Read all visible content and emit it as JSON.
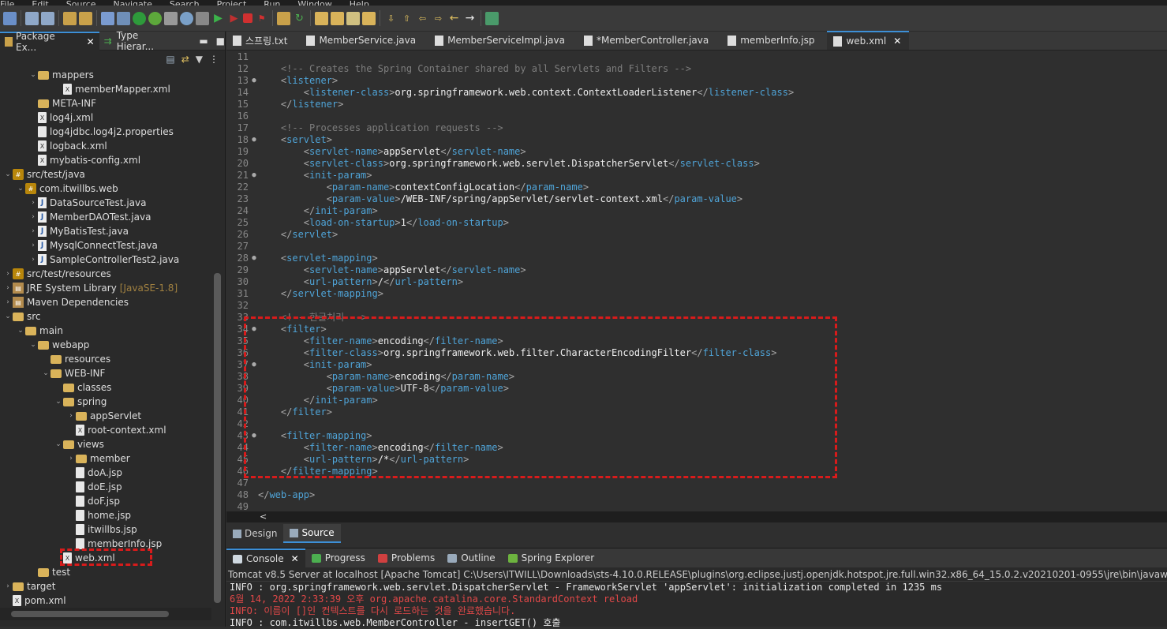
{
  "menu": [
    "File",
    "Edit",
    "Source",
    "Navigate",
    "Search",
    "Project",
    "Run",
    "Window",
    "Help"
  ],
  "left_tabs": [
    {
      "label": "Package Ex...",
      "active": true
    },
    {
      "label": "Type Hierar...",
      "active": false
    }
  ],
  "tree": [
    {
      "indent": 3,
      "tw": "v",
      "icon": "folder",
      "label": "mappers"
    },
    {
      "indent": 5,
      "tw": "",
      "icon": "xml",
      "label": "memberMapper.xml"
    },
    {
      "indent": 3,
      "tw": "",
      "icon": "folder",
      "label": "META-INF"
    },
    {
      "indent": 3,
      "tw": "",
      "icon": "xml",
      "label": "log4j.xml"
    },
    {
      "indent": 3,
      "tw": "",
      "icon": "file",
      "label": "log4jdbc.log4j2.properties"
    },
    {
      "indent": 3,
      "tw": "",
      "icon": "xml",
      "label": "logback.xml"
    },
    {
      "indent": 3,
      "tw": "",
      "icon": "xml",
      "label": "mybatis-config.xml"
    },
    {
      "indent": 1,
      "tw": "v",
      "icon": "pkg",
      "label": "src/test/java"
    },
    {
      "indent": 2,
      "tw": "v",
      "icon": "pkg",
      "label": "com.itwillbs.web"
    },
    {
      "indent": 3,
      "tw": ">",
      "icon": "java",
      "label": "DataSourceTest.java"
    },
    {
      "indent": 3,
      "tw": ">",
      "icon": "java",
      "label": "MemberDAOTest.java"
    },
    {
      "indent": 3,
      "tw": ">",
      "icon": "java",
      "label": "MyBatisTest.java"
    },
    {
      "indent": 3,
      "tw": ">",
      "icon": "java",
      "label": "MysqlConnectTest.java"
    },
    {
      "indent": 3,
      "tw": ">",
      "icon": "java",
      "label": "SampleControllerTest2.java"
    },
    {
      "indent": 1,
      "tw": ">",
      "icon": "pkg",
      "label": "src/test/resources"
    },
    {
      "indent": 1,
      "tw": ">",
      "icon": "lib",
      "label": "JRE System Library",
      "decor": "[JavaSE-1.8]"
    },
    {
      "indent": 1,
      "tw": ">",
      "icon": "lib",
      "label": "Maven Dependencies"
    },
    {
      "indent": 1,
      "tw": "v",
      "icon": "folder",
      "label": "src"
    },
    {
      "indent": 2,
      "tw": "v",
      "icon": "folder",
      "label": "main"
    },
    {
      "indent": 3,
      "tw": "v",
      "icon": "folder",
      "label": "webapp"
    },
    {
      "indent": 4,
      "tw": "",
      "icon": "folder",
      "label": "resources"
    },
    {
      "indent": 4,
      "tw": "v",
      "icon": "folder",
      "label": "WEB-INF"
    },
    {
      "indent": 5,
      "tw": "",
      "icon": "folder",
      "label": "classes"
    },
    {
      "indent": 5,
      "tw": "v",
      "icon": "folder",
      "label": "spring"
    },
    {
      "indent": 6,
      "tw": ">",
      "icon": "folder",
      "label": "appServlet"
    },
    {
      "indent": 6,
      "tw": "",
      "icon": "xml",
      "label": "root-context.xml"
    },
    {
      "indent": 5,
      "tw": "v",
      "icon": "folder",
      "label": "views"
    },
    {
      "indent": 6,
      "tw": ">",
      "icon": "folder",
      "label": "member"
    },
    {
      "indent": 6,
      "tw": "",
      "icon": "file",
      "label": "doA.jsp"
    },
    {
      "indent": 6,
      "tw": "",
      "icon": "file",
      "label": "doE.jsp"
    },
    {
      "indent": 6,
      "tw": "",
      "icon": "file",
      "label": "doF.jsp"
    },
    {
      "indent": 6,
      "tw": "",
      "icon": "file",
      "label": "home.jsp"
    },
    {
      "indent": 6,
      "tw": "",
      "icon": "file",
      "label": "itwillbs.jsp"
    },
    {
      "indent": 6,
      "tw": "",
      "icon": "file",
      "label": "memberInfo.jsp"
    },
    {
      "indent": 5,
      "tw": "",
      "icon": "xml",
      "label": "web.xml"
    },
    {
      "indent": 3,
      "tw": "",
      "icon": "folder",
      "label": "test"
    },
    {
      "indent": 1,
      "tw": ">",
      "icon": "folder",
      "label": "target"
    },
    {
      "indent": 1,
      "tw": "",
      "icon": "xml",
      "label": "pom.xml"
    }
  ],
  "editor_tabs": [
    {
      "label": "스프링.txt",
      "active": false
    },
    {
      "label": "MemberService.java",
      "active": false
    },
    {
      "label": "MemberServiceImpl.java",
      "active": false
    },
    {
      "label": "*MemberController.java",
      "active": false
    },
    {
      "label": "memberInfo.jsp",
      "active": false
    },
    {
      "label": "web.xml",
      "active": true
    }
  ],
  "code_lines": [
    {
      "n": "11",
      "fold": "",
      "parts": []
    },
    {
      "n": "12",
      "fold": "",
      "parts": [
        [
          "cm",
          "    <!-- Creates the Spring Container shared by all Servlets and Filters -->"
        ]
      ]
    },
    {
      "n": "13",
      "fold": "●",
      "parts": [
        [
          "br",
          "    <"
        ],
        [
          "tag",
          "listener"
        ],
        [
          "br",
          ">"
        ]
      ]
    },
    {
      "n": "14",
      "fold": "",
      "parts": [
        [
          "br",
          "        <"
        ],
        [
          "tag",
          "listener-class"
        ],
        [
          "br",
          ">"
        ],
        [
          "tx",
          "org.springframework.web.context.ContextLoaderListener"
        ],
        [
          "br",
          "</"
        ],
        [
          "tag",
          "listener-class"
        ],
        [
          "br",
          ">"
        ]
      ]
    },
    {
      "n": "15",
      "fold": "",
      "parts": [
        [
          "br",
          "    </"
        ],
        [
          "tag",
          "listener"
        ],
        [
          "br",
          ">"
        ]
      ]
    },
    {
      "n": "16",
      "fold": "",
      "parts": []
    },
    {
      "n": "17",
      "fold": "",
      "parts": [
        [
          "cm",
          "    <!-- Processes application requests -->"
        ]
      ]
    },
    {
      "n": "18",
      "fold": "●",
      "parts": [
        [
          "br",
          "    <"
        ],
        [
          "tag",
          "servlet"
        ],
        [
          "br",
          ">"
        ]
      ]
    },
    {
      "n": "19",
      "fold": "",
      "parts": [
        [
          "br",
          "        <"
        ],
        [
          "tag",
          "servlet-name"
        ],
        [
          "br",
          ">"
        ],
        [
          "tx",
          "appServlet"
        ],
        [
          "br",
          "</"
        ],
        [
          "tag",
          "servlet-name"
        ],
        [
          "br",
          ">"
        ]
      ]
    },
    {
      "n": "20",
      "fold": "",
      "parts": [
        [
          "br",
          "        <"
        ],
        [
          "tag",
          "servlet-class"
        ],
        [
          "br",
          ">"
        ],
        [
          "tx",
          "org.springframework.web.servlet.DispatcherServlet"
        ],
        [
          "br",
          "</"
        ],
        [
          "tag",
          "servlet-class"
        ],
        [
          "br",
          ">"
        ]
      ]
    },
    {
      "n": "21",
      "fold": "●",
      "parts": [
        [
          "br",
          "        <"
        ],
        [
          "tag",
          "init-param"
        ],
        [
          "br",
          ">"
        ]
      ]
    },
    {
      "n": "22",
      "fold": "",
      "parts": [
        [
          "br",
          "            <"
        ],
        [
          "tag",
          "param-name"
        ],
        [
          "br",
          ">"
        ],
        [
          "tx",
          "contextConfigLocation"
        ],
        [
          "br",
          "</"
        ],
        [
          "tag",
          "param-name"
        ],
        [
          "br",
          ">"
        ]
      ]
    },
    {
      "n": "23",
      "fold": "",
      "parts": [
        [
          "br",
          "            <"
        ],
        [
          "tag",
          "param-value"
        ],
        [
          "br",
          ">"
        ],
        [
          "tx",
          "/WEB-INF/spring/appServlet/servlet-context.xml"
        ],
        [
          "br",
          "</"
        ],
        [
          "tag",
          "param-value"
        ],
        [
          "br",
          ">"
        ]
      ]
    },
    {
      "n": "24",
      "fold": "",
      "parts": [
        [
          "br",
          "        </"
        ],
        [
          "tag",
          "init-param"
        ],
        [
          "br",
          ">"
        ]
      ]
    },
    {
      "n": "25",
      "fold": "",
      "parts": [
        [
          "br",
          "        <"
        ],
        [
          "tag",
          "load-on-startup"
        ],
        [
          "br",
          ">"
        ],
        [
          "tx",
          "1"
        ],
        [
          "br",
          "</"
        ],
        [
          "tag",
          "load-on-startup"
        ],
        [
          "br",
          ">"
        ]
      ]
    },
    {
      "n": "26",
      "fold": "",
      "parts": [
        [
          "br",
          "    </"
        ],
        [
          "tag",
          "servlet"
        ],
        [
          "br",
          ">"
        ]
      ]
    },
    {
      "n": "27",
      "fold": "",
      "parts": []
    },
    {
      "n": "28",
      "fold": "●",
      "parts": [
        [
          "br",
          "    <"
        ],
        [
          "tag",
          "servlet-mapping"
        ],
        [
          "br",
          ">"
        ]
      ]
    },
    {
      "n": "29",
      "fold": "",
      "parts": [
        [
          "br",
          "        <"
        ],
        [
          "tag",
          "servlet-name"
        ],
        [
          "br",
          ">"
        ],
        [
          "tx",
          "appServlet"
        ],
        [
          "br",
          "</"
        ],
        [
          "tag",
          "servlet-name"
        ],
        [
          "br",
          ">"
        ]
      ]
    },
    {
      "n": "30",
      "fold": "",
      "parts": [
        [
          "br",
          "        <"
        ],
        [
          "tag",
          "url-pattern"
        ],
        [
          "br",
          ">"
        ],
        [
          "tx",
          "/"
        ],
        [
          "br",
          "</"
        ],
        [
          "tag",
          "url-pattern"
        ],
        [
          "br",
          ">"
        ]
      ]
    },
    {
      "n": "31",
      "fold": "",
      "parts": [
        [
          "br",
          "    </"
        ],
        [
          "tag",
          "servlet-mapping"
        ],
        [
          "br",
          ">"
        ]
      ]
    },
    {
      "n": "32",
      "fold": "",
      "parts": []
    },
    {
      "n": "33",
      "fold": "",
      "parts": [
        [
          "cm",
          "    <!-- 한글처리 -->"
        ]
      ]
    },
    {
      "n": "34",
      "fold": "●",
      "parts": [
        [
          "br",
          "    <"
        ],
        [
          "tag",
          "filter"
        ],
        [
          "br",
          ">"
        ]
      ]
    },
    {
      "n": "35",
      "fold": "",
      "parts": [
        [
          "br",
          "        <"
        ],
        [
          "tag",
          "filter-name"
        ],
        [
          "br",
          ">"
        ],
        [
          "tx",
          "encoding"
        ],
        [
          "br",
          "</"
        ],
        [
          "tag",
          "filter-name"
        ],
        [
          "br",
          ">"
        ]
      ]
    },
    {
      "n": "36",
      "fold": "",
      "parts": [
        [
          "br",
          "        <"
        ],
        [
          "tag",
          "filter-class"
        ],
        [
          "br",
          ">"
        ],
        [
          "tx",
          "org.springframework.web.filter.CharacterEncodingFilter"
        ],
        [
          "br",
          "</"
        ],
        [
          "tag",
          "filter-class"
        ],
        [
          "br",
          ">"
        ]
      ]
    },
    {
      "n": "37",
      "fold": "●",
      "parts": [
        [
          "br",
          "        <"
        ],
        [
          "tag",
          "init-param"
        ],
        [
          "br",
          ">"
        ]
      ]
    },
    {
      "n": "38",
      "fold": "",
      "parts": [
        [
          "br",
          "            <"
        ],
        [
          "tag",
          "param-name"
        ],
        [
          "br",
          ">"
        ],
        [
          "tx",
          "encoding"
        ],
        [
          "br",
          "</"
        ],
        [
          "tag",
          "param-name"
        ],
        [
          "br",
          ">"
        ]
      ]
    },
    {
      "n": "39",
      "fold": "",
      "parts": [
        [
          "br",
          "            <"
        ],
        [
          "tag",
          "param-value"
        ],
        [
          "br",
          ">"
        ],
        [
          "tx",
          "UTF-8"
        ],
        [
          "br",
          "</"
        ],
        [
          "tag",
          "param-value"
        ],
        [
          "br",
          ">"
        ]
      ]
    },
    {
      "n": "40",
      "fold": "",
      "parts": [
        [
          "br",
          "        </"
        ],
        [
          "tag",
          "init-param"
        ],
        [
          "br",
          ">"
        ]
      ]
    },
    {
      "n": "41",
      "fold": "",
      "parts": [
        [
          "br",
          "    </"
        ],
        [
          "tag",
          "filter"
        ],
        [
          "br",
          ">"
        ]
      ]
    },
    {
      "n": "42",
      "fold": "",
      "parts": []
    },
    {
      "n": "43",
      "fold": "●",
      "parts": [
        [
          "br",
          "    <"
        ],
        [
          "tag",
          "filter-mapping"
        ],
        [
          "br",
          ">"
        ]
      ]
    },
    {
      "n": "44",
      "fold": "",
      "parts": [
        [
          "br",
          "        <"
        ],
        [
          "tag",
          "filter-name"
        ],
        [
          "br",
          ">"
        ],
        [
          "tx",
          "encoding"
        ],
        [
          "br",
          "</"
        ],
        [
          "tag",
          "filter-name"
        ],
        [
          "br",
          ">"
        ]
      ]
    },
    {
      "n": "45",
      "fold": "",
      "parts": [
        [
          "br",
          "        <"
        ],
        [
          "tag",
          "url-pattern"
        ],
        [
          "br",
          ">"
        ],
        [
          "tx",
          "/*"
        ],
        [
          "br",
          "</"
        ],
        [
          "tag",
          "url-pattern"
        ],
        [
          "br",
          ">"
        ]
      ]
    },
    {
      "n": "46",
      "fold": "",
      "parts": [
        [
          "br",
          "    </"
        ],
        [
          "tag",
          "filter-mapping"
        ],
        [
          "br",
          ">"
        ]
      ]
    },
    {
      "n": "47",
      "fold": "",
      "parts": []
    },
    {
      "n": "48",
      "fold": "",
      "parts": [
        [
          "br",
          "</"
        ],
        [
          "tag",
          "web-app"
        ],
        [
          "br",
          ">"
        ]
      ]
    },
    {
      "n": "49",
      "fold": "",
      "parts": []
    }
  ],
  "design_tabs": [
    {
      "label": "Design",
      "active": false
    },
    {
      "label": "Source",
      "active": true
    }
  ],
  "console_tabs": [
    {
      "label": "Console",
      "active": true,
      "icon": "console-icon"
    },
    {
      "label": "Progress",
      "active": false,
      "icon": "progress-icon"
    },
    {
      "label": "Problems",
      "active": false,
      "icon": "problems-icon"
    },
    {
      "label": "Outline",
      "active": false,
      "icon": "outline-icon"
    },
    {
      "label": "Spring Explorer",
      "active": false,
      "icon": "spring-icon"
    }
  ],
  "console_title": "Tomcat v8.5 Server at localhost [Apache Tomcat] C:\\Users\\ITWILL\\Downloads\\sts-4.10.0.RELEASE\\plugins\\org.eclipse.justj.openjdk.hotspot.jre.full.win32.x86_64_15.0.2.v20210201-0955\\jre\\bin\\javaw.exe  (2022. 6.",
  "console_lines": [
    {
      "kind": "info",
      "text": "INFO : org.springframework.web.servlet.DispatcherServlet - FrameworkServlet 'appServlet': initialization completed in 1235 ms"
    },
    {
      "kind": "red",
      "text": "6월 14, 2022 2:33:39 오후 org.apache.catalina.core.StandardContext reload"
    },
    {
      "kind": "red",
      "text": "INFO: 이름이 []인 컨텍스트를 다시 로드하는 것을 완료했습니다."
    },
    {
      "kind": "info",
      "text": "INFO : com.itwillbs.web.MemberController - insertGET() 호출"
    }
  ],
  "editor_hscroll_glyph": "<"
}
